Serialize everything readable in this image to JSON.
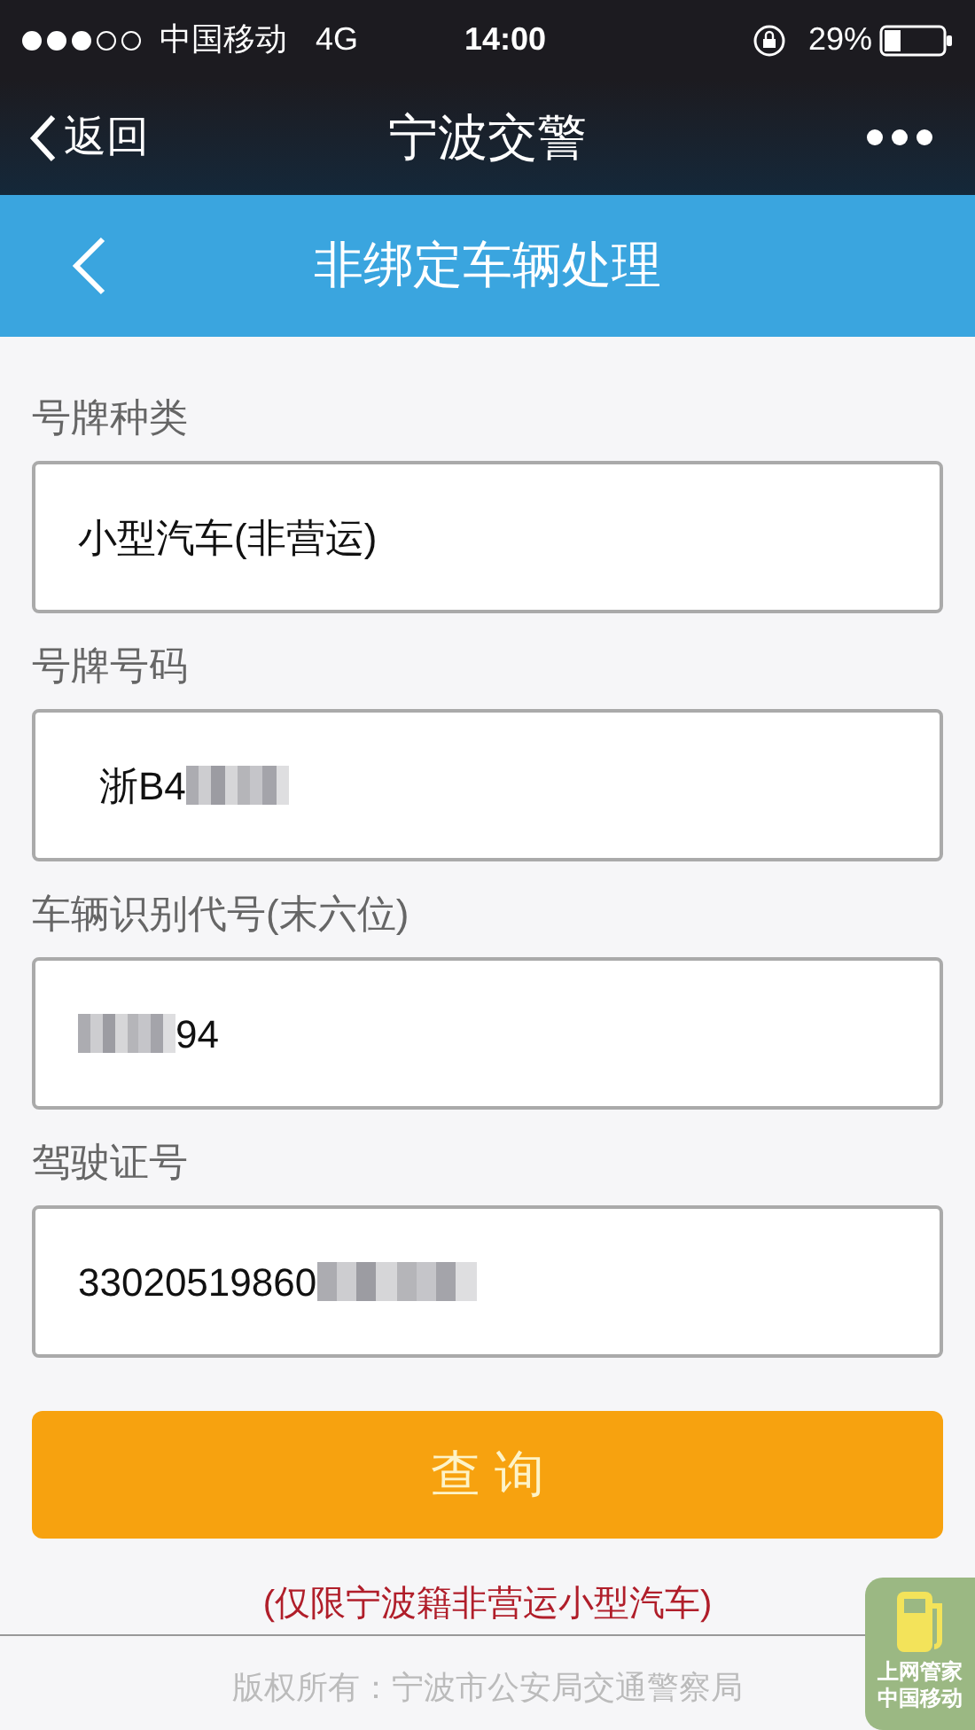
{
  "status_bar": {
    "carrier": "中国移动",
    "network": "4G",
    "time": "14:00",
    "battery": "29%"
  },
  "nav": {
    "back": "返回",
    "title": "宁波交警"
  },
  "header": {
    "title": "非绑定车辆处理"
  },
  "fields": [
    {
      "label": "号牌种类",
      "value": "小型汽车(非营运)",
      "blurred_before": false,
      "blurred_after": false
    },
    {
      "label": "号牌号码",
      "value": "浙B4",
      "blurred_before": false,
      "blurred_after": true
    },
    {
      "label": "车辆识别代号(末六位)",
      "value": "94",
      "blurred_before": true,
      "blurred_after": false
    },
    {
      "label": "驾驶证号",
      "value": "33020519860",
      "blurred_before": false,
      "blurred_after": true
    }
  ],
  "submit_button": "查 询",
  "note": "(仅限宁波籍非营运小型汽车)",
  "footer": "版权所有：宁波市公安局交通警察局",
  "widget": {
    "lines": [
      "上网管家",
      "中国移动"
    ]
  }
}
